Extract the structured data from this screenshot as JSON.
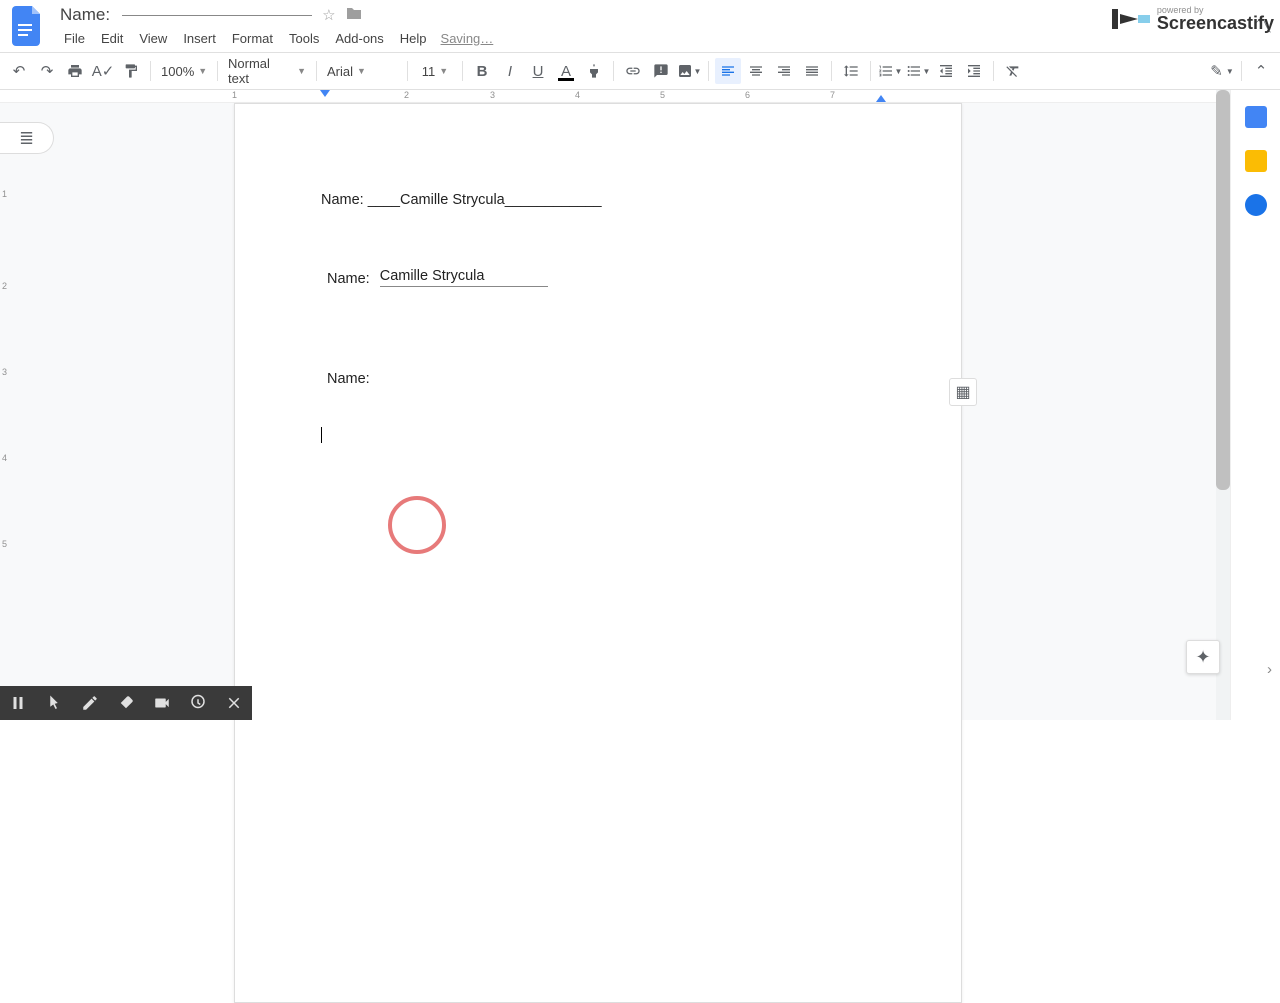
{
  "header": {
    "title": "Name:",
    "star_label": "star-icon",
    "folder_label": "folder-icon",
    "menus": [
      "File",
      "Edit",
      "View",
      "Insert",
      "Format",
      "Tools",
      "Add-ons",
      "Help"
    ],
    "saving": "Saving…"
  },
  "toolbar": {
    "zoom": "100%",
    "style": "Normal text",
    "font": "Arial",
    "size": "11"
  },
  "document": {
    "line1_pre": "Name: ____",
    "line1_name": "Camille Strycula",
    "line1_post": "____________",
    "table_label": "Name:",
    "table_value": "Camille Strycula",
    "solo_label": "Name:"
  },
  "ruler": {
    "nums": [
      "1",
      "2",
      "3",
      "4",
      "5",
      "6",
      "7"
    ]
  },
  "watermark": {
    "powered": "powered by",
    "brand": "Screencastify"
  }
}
